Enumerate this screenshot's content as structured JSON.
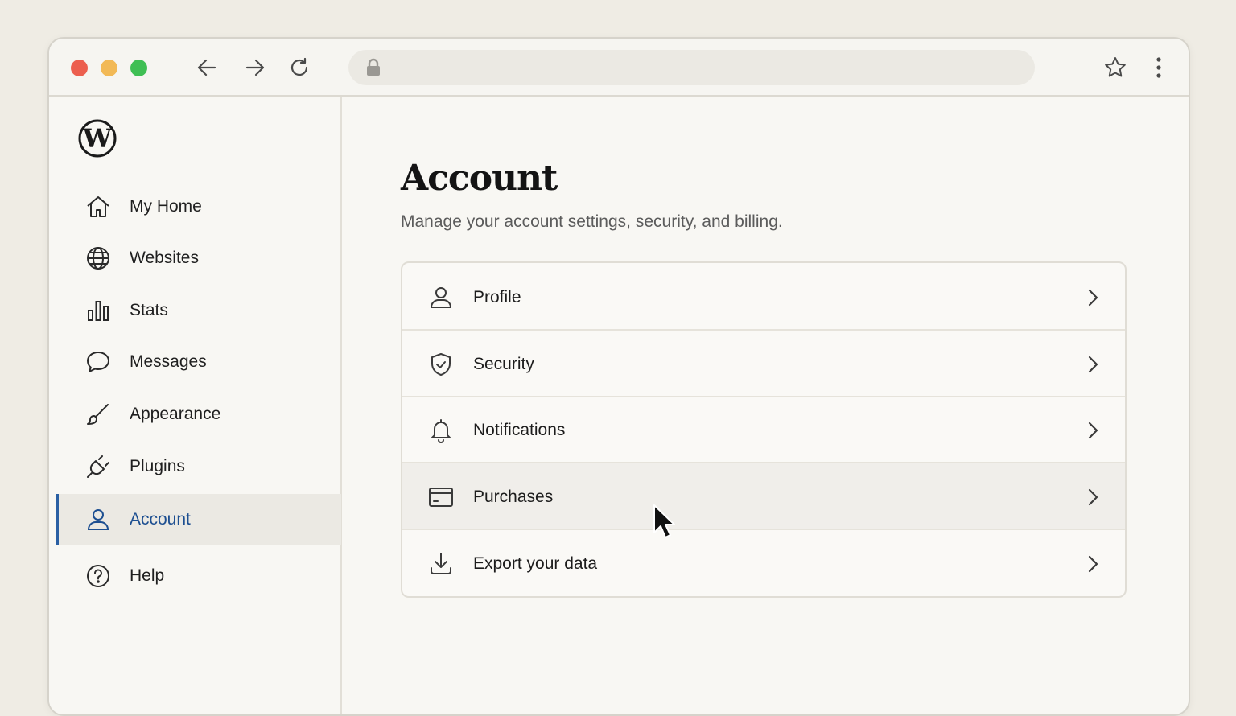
{
  "sidebar": {
    "logo_icon": "wordpress-logo",
    "items": [
      {
        "label": "My Home",
        "icon": "home-icon"
      },
      {
        "label": "Websites",
        "icon": "globe-icon"
      },
      {
        "label": "Stats",
        "icon": "bar-chart-icon"
      },
      {
        "label": "Messages",
        "icon": "chat-bubble-icon"
      },
      {
        "label": "Appearance",
        "icon": "brush-icon"
      },
      {
        "label": "Plugins",
        "icon": "plug-icon"
      },
      {
        "label": "Account",
        "icon": "user-icon",
        "active": true
      },
      {
        "label": "Help",
        "icon": "help-circle-icon"
      }
    ]
  },
  "main": {
    "title": "Account",
    "subtitle": "Manage your account settings, security, and billing.",
    "rows": [
      {
        "label": "Profile",
        "icon": "user-icon"
      },
      {
        "label": "Security",
        "icon": "shield-check-icon"
      },
      {
        "label": "Notifications",
        "icon": "bell-icon"
      },
      {
        "label": "Purchases",
        "icon": "credit-card-icon",
        "hovered": true
      },
      {
        "label": "Export your data",
        "icon": "download-icon"
      }
    ]
  },
  "colors": {
    "accent": "#1d4f91",
    "active_bar": "#2a5fa3",
    "background": "#efece4",
    "traffic_red": "#ec5f4f",
    "traffic_yellow": "#f2b956",
    "traffic_green": "#3fbf54"
  }
}
